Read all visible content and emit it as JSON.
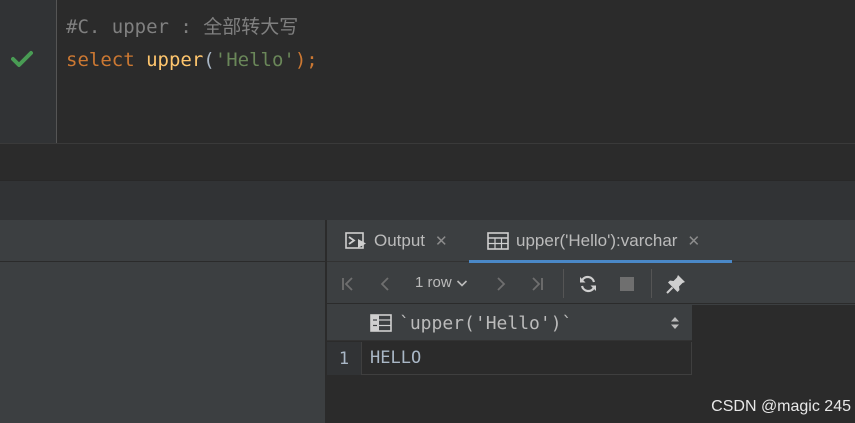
{
  "editor": {
    "comment_line": "#C. upper : ",
    "comment_cjk": "全部转大写",
    "code": {
      "keyword": "select",
      "function": "upper",
      "open_paren": "(",
      "string": "'Hello'",
      "close": ");"
    },
    "gutter_icon": "check-icon"
  },
  "results": {
    "tabs": [
      {
        "label": "Output",
        "icon": "console-icon"
      },
      {
        "label": "upper('Hello'):varchar",
        "icon": "table-icon",
        "active": true
      }
    ],
    "toolbar": {
      "rows_label": "1 row",
      "buttons": [
        "first-page-icon",
        "prev-page-icon",
        "next-page-icon",
        "last-page-icon",
        "refresh-icon",
        "stop-icon",
        "pin-icon"
      ]
    },
    "grid": {
      "column_header": "`upper('Hello')`",
      "rows": [
        {
          "num": "1",
          "value": "HELLO"
        }
      ]
    }
  },
  "watermark": "CSDN @magic 245",
  "colors": {
    "editor_bg": "#2b2b2b",
    "panel_bg": "#3c3f41",
    "keyword": "#cc7832",
    "function": "#ffc66d",
    "string": "#6a8759",
    "comment": "#808080",
    "active_tab": "#4a88c7",
    "check": "#499c54"
  }
}
